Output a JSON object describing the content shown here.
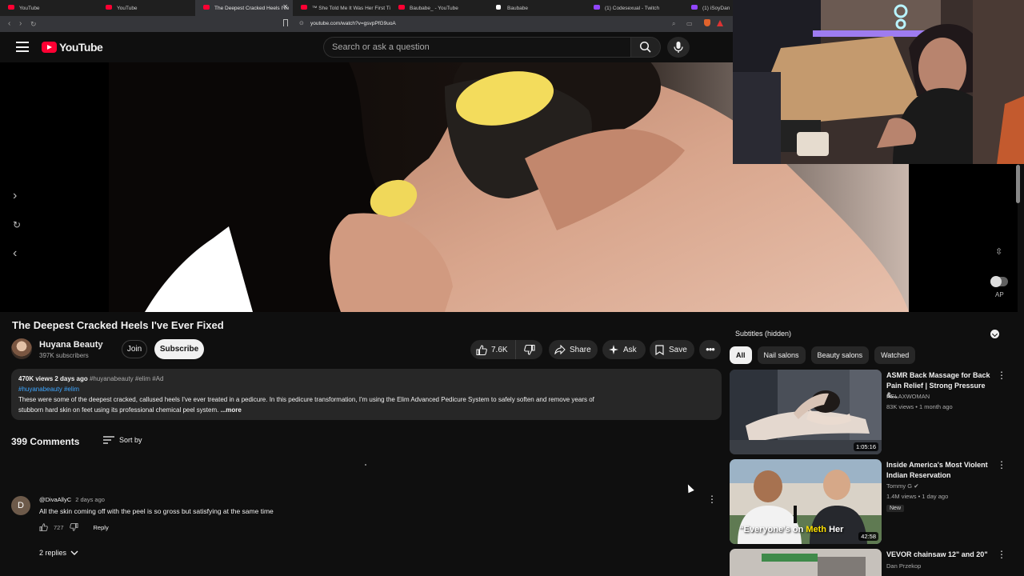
{
  "browser": {
    "tabs": [
      {
        "label": "YouTube",
        "icon": "youtube-favicon",
        "active": false
      },
      {
        "label": "YouTube",
        "icon": "youtube-favicon",
        "active": false
      },
      {
        "label": "The Deepest Cracked Heels I've",
        "icon": "youtube-favicon",
        "active": true
      },
      {
        "label": "™ She Told Me It Was Her First Ti",
        "icon": "youtube-favicon",
        "active": false
      },
      {
        "label": "Baubabe_ - YouTube",
        "icon": "youtube-favicon",
        "active": false
      },
      {
        "label": "Baubabe",
        "icon": "bookmark-favicon",
        "active": false
      },
      {
        "label": "(1) Codesexual - Twitch",
        "icon": "twitch-favicon",
        "active": false
      },
      {
        "label": "(1) iSoyDan",
        "icon": "twitch-favicon",
        "active": false
      }
    ],
    "url": "youtube.com/watch?v=gsvpPfG9uoA"
  },
  "header": {
    "logo_text": "YouTube",
    "search_placeholder": "Search or ask a question"
  },
  "player": {
    "autoplay_label": "AP"
  },
  "video": {
    "title": "The Deepest Cracked Heels I've Ever Fixed",
    "channel": "Huyana Beauty",
    "subscribers": "397K subscribers",
    "join_label": "Join",
    "subscribe_label": "Subscribe",
    "likes": "7.6K",
    "share_label": "Share",
    "ask_label": "Ask",
    "save_label": "Save"
  },
  "description": {
    "views_date": "470K views  2 days ago",
    "hashtags_inline": "#huyanabeauty #elim #Ad",
    "hashtags_line": "#huyanabeauty #elim",
    "text_line1": "These were some of the deepest cracked, callused heels I've ever treated in a pedicure. In this pedicure transformation, I'm using the Elim Advanced Pedicure System to safely soften and remove years of",
    "text_line2": "stubborn hard skin on feet using its professional chemical peel system.",
    "more_label": "...more"
  },
  "comments": {
    "count_label": "399 Comments",
    "sort_label": "Sort by",
    "items": [
      {
        "avatar_letter": "D",
        "author": "@DivaAllyC",
        "time": "2 days ago",
        "text": "All the skin coming off with the peel is so gross but satisfying at the same time",
        "likes": "727",
        "reply_label": "Reply",
        "replies_label": "2 replies"
      }
    ]
  },
  "sidebar": {
    "subtitles_label": "Subtitles (hidden)",
    "chips": [
      "All",
      "Nail salons",
      "Beauty salons",
      "Watched"
    ],
    "recommendations": [
      {
        "title": "ASMR Back Massage for Back Pain Relief | Strong Pressure &...",
        "channel": "RELAXWOMAN",
        "meta": "83K views • 1 month ago",
        "duration": "1:05:16",
        "verified": false,
        "is_new": false
      },
      {
        "title": "Inside America's Most Violent Indian Reservation",
        "channel": "Tommy G",
        "meta": "1.4M views • 1 day ago",
        "duration": "42:58",
        "verified": true,
        "is_new": true,
        "new_label": "New",
        "thumb_caption_a": "“Everyone’s on ",
        "thumb_caption_b": "Meth",
        "thumb_caption_c": " Her"
      },
      {
        "title": "VEVOR chainsaw 12\" and 20\"",
        "channel": "Dan Przekop",
        "meta": "",
        "duration": "",
        "verified": false,
        "is_new": false
      }
    ]
  },
  "colors": {
    "background": "#0f0f0f",
    "accent_red": "#ff0033",
    "link_blue": "#3ea6ff",
    "chip_bg": "#272727",
    "nail_yellow": "#f3dc5c"
  }
}
